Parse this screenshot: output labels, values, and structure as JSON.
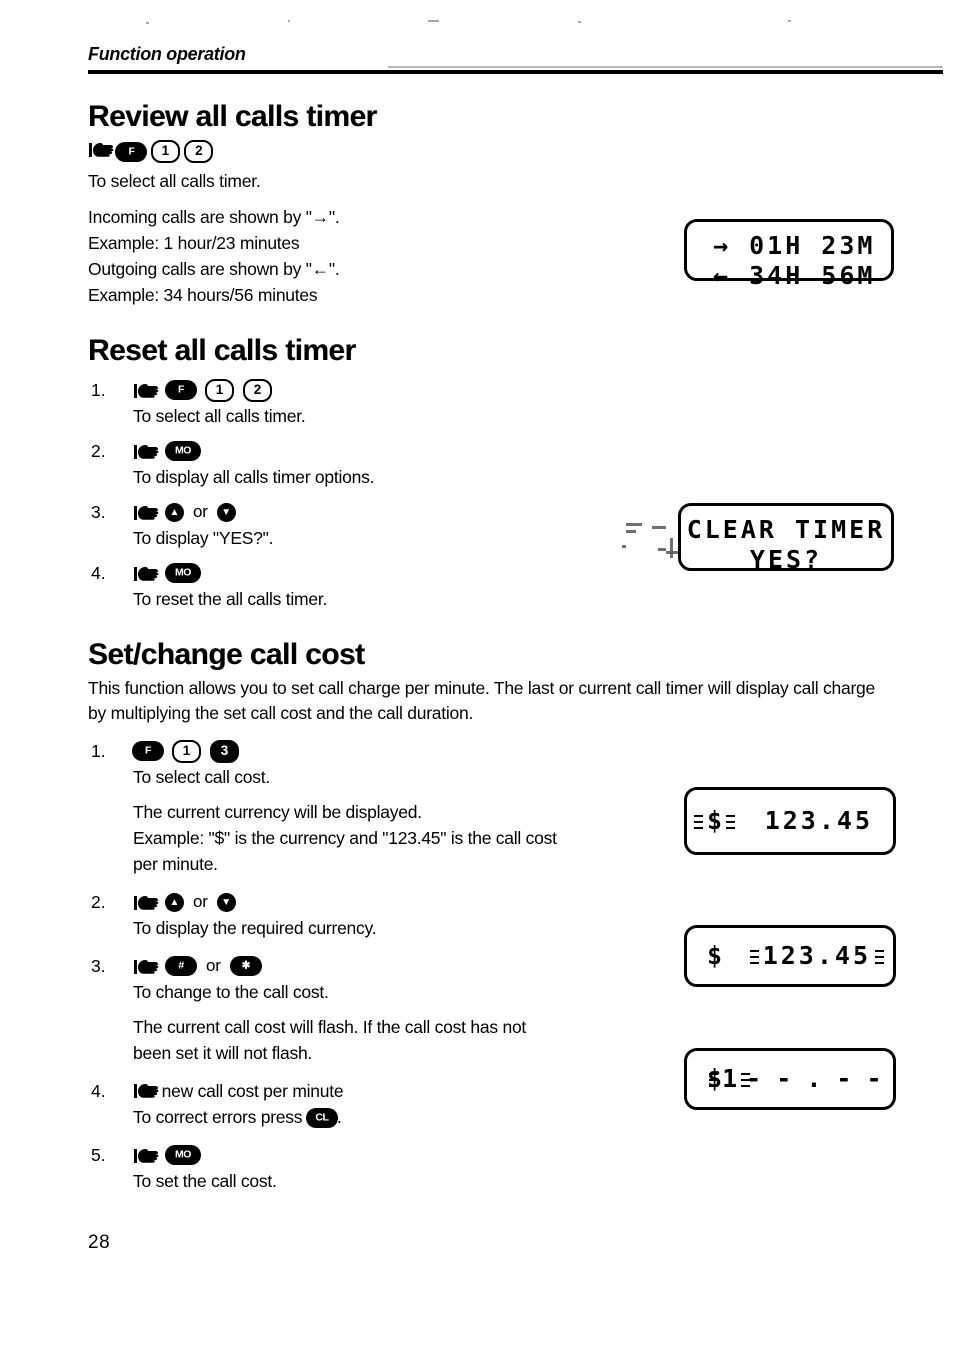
{
  "page": {
    "running_header": "Function operation",
    "page_number": "28"
  },
  "sections": [
    {
      "id": "review-all-calls-timer",
      "heading": "Review all calls timer",
      "keys": [
        "hand",
        "F",
        "1",
        "2"
      ],
      "lines": [
        "To select all calls timer.",
        "Incoming calls are shown by \"→\".",
        "Example: 1 hour/23 minutes",
        "Outgoing calls are shown by \"←\".",
        "Example: 34 hours/56 minutes"
      ]
    },
    {
      "id": "reset-all-calls-timer",
      "heading": "Reset all calls timer",
      "steps": [
        {
          "num": "1.",
          "keys": [
            "hand",
            "F",
            "1",
            "2"
          ],
          "text": "To select all calls timer."
        },
        {
          "num": "2.",
          "keys": [
            "hand",
            "MO"
          ],
          "text": "To display all calls timer options."
        },
        {
          "num": "3.",
          "keys": [
            "hand",
            "up",
            "or",
            "down"
          ],
          "text": "To display \"YES?\"."
        },
        {
          "num": "4.",
          "keys": [
            "hand",
            "MO"
          ],
          "text": "To reset the all calls timer."
        }
      ]
    },
    {
      "id": "set-change-call-cost",
      "heading": "Set/change call cost",
      "intro": "This function allows you to set call charge per minute. The last or current call timer will display call charge by multiplying the set call cost and the call duration.",
      "steps": [
        {
          "num": "1.",
          "keys": [
            "F",
            "1",
            "3"
          ],
          "text": "To select call cost.",
          "sub": [
            "The current currency will be displayed.",
            "Example: \"$\" is the currency and \"123.45\" is the call cost",
            "per minute."
          ]
        },
        {
          "num": "2.",
          "keys": [
            "hand",
            "up",
            "or",
            "down"
          ],
          "text": "To display the required currency."
        },
        {
          "num": "3.",
          "keys": [
            "hand",
            "hash",
            "or",
            "star"
          ],
          "text": "To change to the call cost.",
          "sub": [
            "The current call cost will flash. If the call cost has not",
            "been set it will not flash."
          ]
        },
        {
          "num": "4.",
          "keys": [
            "hand"
          ],
          "text_inline": "new call cost per minute",
          "sub_inline": {
            "before": "To correct errors press ",
            "key": "CL",
            "after": "."
          }
        },
        {
          "num": "5.",
          "keys": [
            "hand",
            "MO"
          ],
          "text": "To set the call cost."
        }
      ]
    }
  ],
  "displays": [
    {
      "id": "all-calls-timer-display",
      "line1": "→ 01H 23M",
      "line2": "← 34H 56M"
    },
    {
      "id": "clear-timer-display",
      "line1": "CLEAR TIMER",
      "line2": "YES?"
    },
    {
      "id": "currency-display",
      "symbol": "$",
      "value": "123.45",
      "flashing": "symbol"
    },
    {
      "id": "call-cost-display",
      "symbol": "$",
      "value": "123.45",
      "flashing": "value"
    },
    {
      "id": "call-cost-entry-display",
      "symbol": "$",
      "value": "1",
      "placeholder": "- - . - -",
      "flashing": "value"
    }
  ],
  "icon_labels": {
    "hand": "pointing-hand",
    "F": "F",
    "MO": "MO",
    "CL": "CL",
    "up": "▲",
    "down": "▼",
    "hash": "#",
    "star": "✱",
    "or": "or"
  }
}
